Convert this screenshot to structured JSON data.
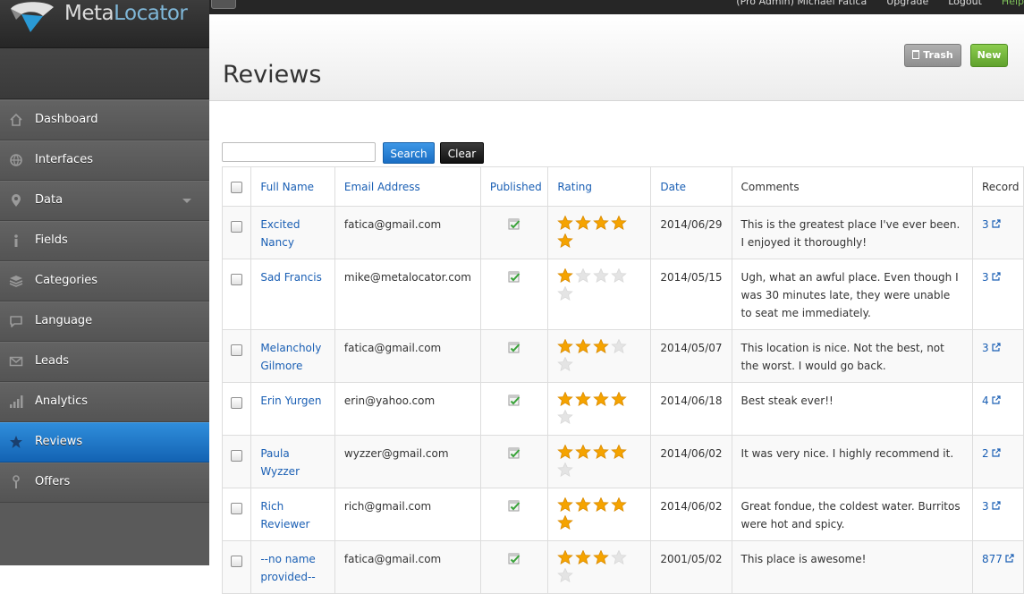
{
  "app": {
    "logo_part1": "Meta",
    "logo_part2": "Locator"
  },
  "topbar": {
    "links": [
      "(Pro Admin) Michael Fatica",
      "Upgrade",
      "Logout",
      "Help"
    ]
  },
  "sidebar": {
    "items": [
      {
        "label": "Dashboard",
        "icon": "home-icon",
        "active": false
      },
      {
        "label": "Interfaces",
        "icon": "globe-icon",
        "active": false
      },
      {
        "label": "Data",
        "icon": "map-pin-icon",
        "active": false,
        "has_caret": true
      },
      {
        "label": "Fields",
        "icon": "info-icon",
        "active": false
      },
      {
        "label": "Categories",
        "icon": "layers-icon",
        "active": false
      },
      {
        "label": "Language",
        "icon": "speech-bubble-icon",
        "active": false
      },
      {
        "label": "Leads",
        "icon": "envelope-icon",
        "active": false
      },
      {
        "label": "Analytics",
        "icon": "bar-chart-icon",
        "active": false
      },
      {
        "label": "Reviews",
        "icon": "star-icon",
        "active": true
      },
      {
        "label": "Offers",
        "icon": "pin-icon",
        "active": false
      }
    ]
  },
  "header": {
    "title": "Reviews",
    "trash_label": "Trash",
    "new_label": "New"
  },
  "search": {
    "value": "",
    "placeholder": "",
    "search_label": "Search",
    "clear_label": "Clear"
  },
  "table": {
    "columns": [
      "Full Name",
      "Email Address",
      "Published",
      "Rating",
      "Date",
      "Comments",
      "Record"
    ],
    "rows": [
      {
        "name": "Excited Nancy",
        "email": "fatica@gmail.com",
        "published": true,
        "rating": 5,
        "date": "2014/06/29",
        "comments": "This is the greatest place I've ever been. I enjoyed it thoroughly!",
        "record": "3"
      },
      {
        "name": "Sad Francis",
        "email": "mike@metalocator.com",
        "published": true,
        "rating": 1,
        "date": "2014/05/15",
        "comments": "Ugh, what an awful place. Even though I was 30 minutes late, they were unable to seat me immediately.",
        "record": "3"
      },
      {
        "name": "Melancholy Gilmore",
        "email": "fatica@gmail.com",
        "published": true,
        "rating": 3,
        "date": "2014/05/07",
        "comments": "This location is nice. Not the best, not the worst. I would go back.",
        "record": "3"
      },
      {
        "name": "Erin Yurgen",
        "email": "erin@yahoo.com",
        "published": true,
        "rating": 4,
        "date": "2014/06/18",
        "comments": "Best steak ever!!",
        "record": "4"
      },
      {
        "name": "Paula Wyzzer",
        "email": "wyzzer@gmail.com",
        "published": true,
        "rating": 4,
        "date": "2014/06/02",
        "comments": "It was very nice. I highly recommend it.",
        "record": "2"
      },
      {
        "name": "Rich Reviewer",
        "email": "rich@gmail.com",
        "published": true,
        "rating": 5,
        "date": "2014/06/02",
        "comments": "Great fondue, the coldest water. Burritos were hot and spicy.",
        "record": "3"
      },
      {
        "name": "--no name provided--",
        "email": "fatica@gmail.com",
        "published": true,
        "rating": 3,
        "date": "2001/05/02",
        "comments": "This place is awesome!",
        "record": "877"
      }
    ]
  },
  "colors": {
    "accent": "#1a6ec4",
    "new_button": "#6db33f",
    "link": "#1a5fb4",
    "star_on": "#f5a300",
    "star_off": "#d8d8d8"
  }
}
